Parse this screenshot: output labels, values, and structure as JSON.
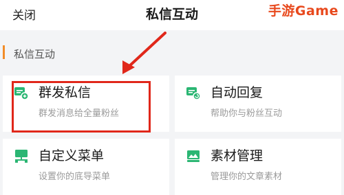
{
  "header": {
    "close_label": "关闭",
    "title": "私信互动"
  },
  "watermark": "手游Game",
  "section": {
    "title": "私信互动",
    "accent_color": "#f28c28"
  },
  "cards": [
    {
      "icon": "broadcast-message-icon",
      "title": "群发私信",
      "desc": "群发消息给全量粉丝"
    },
    {
      "icon": "auto-reply-icon",
      "title": "自动回复",
      "desc": "帮助你与粉丝互动"
    },
    {
      "icon": "custom-menu-icon",
      "title": "自定义菜单",
      "desc": "设置你的底导菜单"
    },
    {
      "icon": "material-management-icon",
      "title": "素材管理",
      "desc": "管理你的文章素材"
    }
  ],
  "colors": {
    "icon_green": "#2bb673",
    "highlight_red": "#e0271a",
    "watermark_orange": "#e8491d"
  }
}
